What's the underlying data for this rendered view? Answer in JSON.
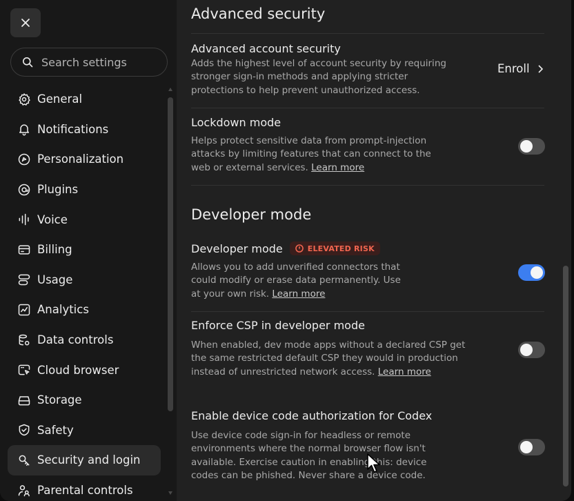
{
  "sidebar": {
    "close_label": "×",
    "search_placeholder": "Search settings",
    "items": [
      {
        "label": "General",
        "icon": "gear-icon"
      },
      {
        "label": "Notifications",
        "icon": "bell-icon"
      },
      {
        "label": "Personalization",
        "icon": "personalization-icon"
      },
      {
        "label": "Plugins",
        "icon": "plugins-icon"
      },
      {
        "label": "Voice",
        "icon": "voice-waveform-icon"
      },
      {
        "label": "Billing",
        "icon": "credit-card-icon"
      },
      {
        "label": "Usage",
        "icon": "usage-icon"
      },
      {
        "label": "Analytics",
        "icon": "analytics-chart-icon"
      },
      {
        "label": "Data controls",
        "icon": "database-icon"
      },
      {
        "label": "Cloud browser",
        "icon": "cloud-browser-icon"
      },
      {
        "label": "Storage",
        "icon": "storage-drive-icon"
      },
      {
        "label": "Safety",
        "icon": "shield-icon"
      },
      {
        "label": "Security and login",
        "icon": "security-key-icon",
        "active": true
      },
      {
        "label": "Parental controls",
        "icon": "parental-icon"
      }
    ]
  },
  "main": {
    "advanced_security": {
      "heading": "Advanced security",
      "account_security": {
        "title": "Advanced account security",
        "description": "Adds the highest level of account security by requiring stronger sign-in methods and applying stricter protections to help prevent unauthorized access.",
        "action_label": "Enroll"
      },
      "lockdown": {
        "title": "Lockdown mode",
        "description": "Helps protect sensitive data from prompt-injection attacks by limiting features that can connect to the web or external services.",
        "link": "Learn more",
        "enabled": false
      }
    },
    "developer_mode": {
      "heading": "Developer mode",
      "developer": {
        "title": "Developer mode",
        "badge": "ELEVATED RISK",
        "description": "Allows you to add unverified connectors that could modify or erase data permanently. Use at your own risk.",
        "link": "Learn more",
        "enabled": true
      },
      "csp": {
        "title": "Enforce CSP in developer mode",
        "description": "When enabled, dev mode apps without a declared CSP get the same restricted default CSP they would in production instead of unrestricted network access.",
        "link": "Learn more",
        "enabled": false
      },
      "device_code": {
        "title": "Enable device code authorization for Codex",
        "description": "Use device code sign-in for headless or remote environments where the normal browser flow isn't available. Exercise caution in enabling this: device codes can be phished. Never share a device code.",
        "enabled": false
      }
    }
  },
  "colors": {
    "accent": "#3c7ef0",
    "risk": "#f0654f",
    "background": "#212121",
    "sidebar": "#181818"
  }
}
